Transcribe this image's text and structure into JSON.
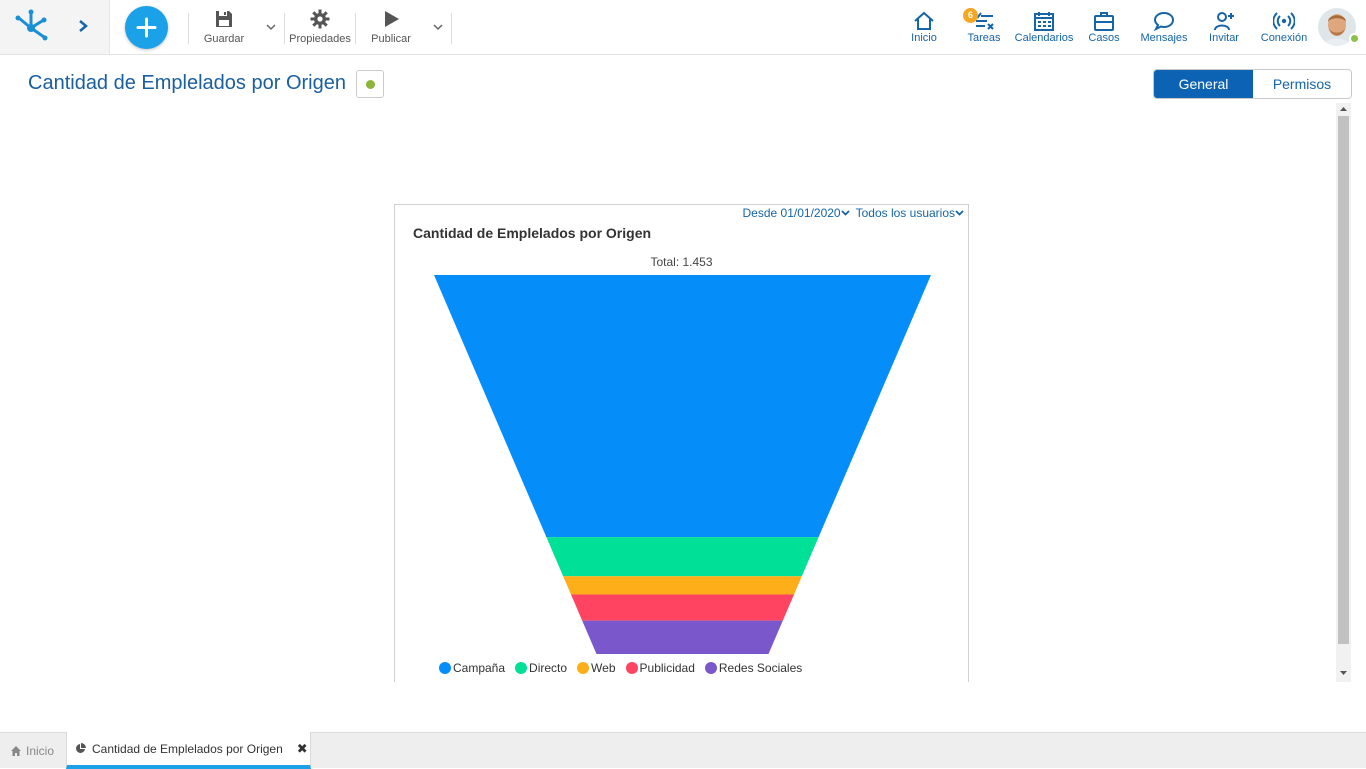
{
  "toolbar": {
    "save_label": "Guardar",
    "properties_label": "Propiedades",
    "publish_label": "Publicar"
  },
  "nav": {
    "home": "Inicio",
    "tasks": "Tareas",
    "tasks_badge": "6",
    "calendars": "Calendarios",
    "cases": "Casos",
    "messages": "Mensajes",
    "invite": "Invitar",
    "connection": "Conexión"
  },
  "page": {
    "title": "Cantidad de Emplelados por Origen",
    "tabs": {
      "general": "General",
      "permissions": "Permisos"
    }
  },
  "chart_panel": {
    "filter_date": "Desde 01/01/2020",
    "filter_users": "Todos los usuarios",
    "total_label": "Total: 1.453"
  },
  "chart_data": {
    "type": "funnel",
    "title": "Cantidad de Emplelados por Origen",
    "total": 1453,
    "categories": [
      "Campaña",
      "Directo",
      "Web",
      "Publicidad",
      "Redes Sociales"
    ],
    "values": [
      1005,
      150,
      70,
      100,
      128
    ],
    "colors": [
      "#058dfa",
      "#00e096",
      "#fdae19",
      "#fe4461",
      "#7a58cc"
    ],
    "legend_position": "bottom"
  },
  "bottom_tabs": {
    "home": "Inicio",
    "active": "Cantidad de Emplelados por Origen"
  },
  "colors": {
    "primary": "#0d63b3",
    "accent": "#1aa1e7",
    "title": "#1a5fa0",
    "status_active": "#8bb43a",
    "badge": "#f5a623"
  }
}
